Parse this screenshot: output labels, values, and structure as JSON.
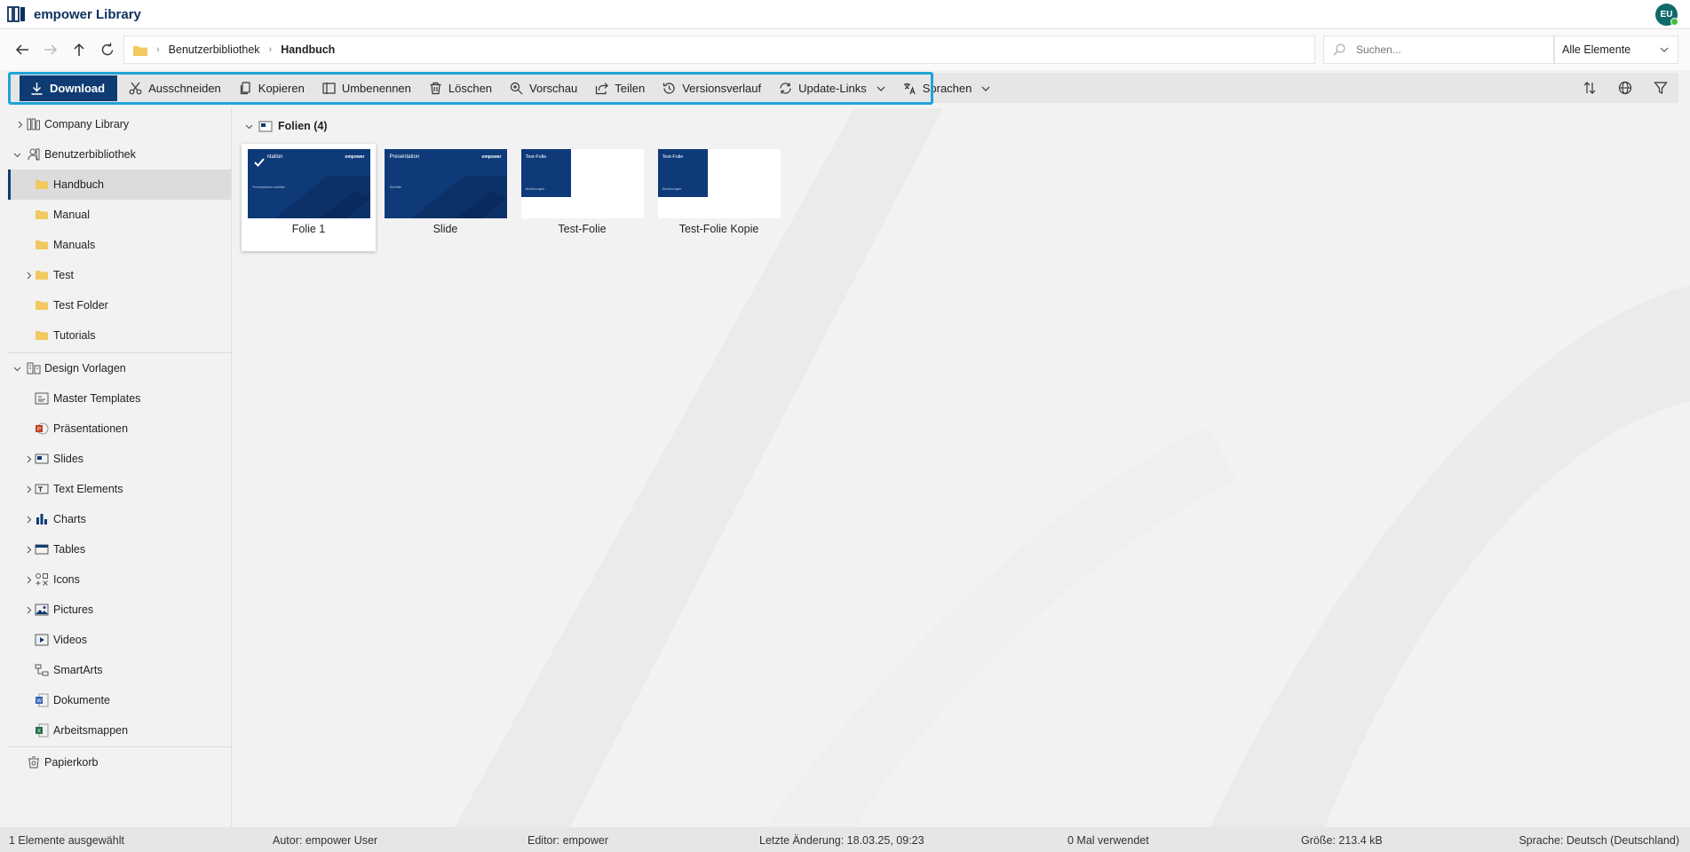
{
  "app": {
    "title": "empower Library",
    "avatar_initials": "EU"
  },
  "nav": {
    "breadcrumb": [
      "Benutzerbibliothek",
      "Handbuch"
    ],
    "search_placeholder": "Suchen...",
    "filter_value": "Alle Elemente"
  },
  "toolbar": {
    "items": [
      {
        "label": "Download",
        "icon": "download-icon"
      },
      {
        "label": "Ausschneiden",
        "icon": "scissors-icon"
      },
      {
        "label": "Kopieren",
        "icon": "copy-icon"
      },
      {
        "label": "Umbenennen",
        "icon": "rename-icon"
      },
      {
        "label": "Löschen",
        "icon": "trash-icon"
      },
      {
        "label": "Vorschau",
        "icon": "zoom-icon"
      },
      {
        "label": "Teilen",
        "icon": "share-icon"
      },
      {
        "label": "Versionsverlauf",
        "icon": "history-icon"
      },
      {
        "label": "Update-Links",
        "icon": "update-links-icon"
      },
      {
        "label": "Sprachen",
        "icon": "language-icon"
      }
    ],
    "right_icons": [
      "sort-icon",
      "globe-icon",
      "filter-icon"
    ]
  },
  "sidebar": {
    "items": [
      {
        "label": "Company Library"
      },
      {
        "label": "Benutzerbibliothek"
      },
      {
        "label": "Handbuch"
      },
      {
        "label": "Manual"
      },
      {
        "label": "Manuals"
      },
      {
        "label": "Test"
      },
      {
        "label": "Test Folder"
      },
      {
        "label": "Tutorials"
      },
      {
        "label": "Design Vorlagen"
      },
      {
        "label": "Master Templates"
      },
      {
        "label": "Präsentationen"
      },
      {
        "label": "Slides"
      },
      {
        "label": "Text Elements"
      },
      {
        "label": "Charts"
      },
      {
        "label": "Tables"
      },
      {
        "label": "Icons"
      },
      {
        "label": "Pictures"
      },
      {
        "label": "Videos"
      },
      {
        "label": "SmartArts"
      },
      {
        "label": "Dokumente"
      },
      {
        "label": "Arbeitsmappen"
      },
      {
        "label": "Papierkorb"
      }
    ]
  },
  "main": {
    "group_title": "Folien (4)",
    "tiles": [
      {
        "label": "Folie 1",
        "thumb_title": "ntation",
        "thumb_sub": "Presentation subtitle",
        "brand": "empower"
      },
      {
        "label": "Slide",
        "thumb_title": "Presentation",
        "thumb_sub": "Subtitle",
        "brand": "empower"
      },
      {
        "label": "Test-Folie",
        "thumb_title": "Test-Folie",
        "thumb_sub": "Änderungen"
      },
      {
        "label": "Test-Folie Kopie",
        "thumb_title": "Test-Folie",
        "thumb_sub": "Änderungen"
      }
    ]
  },
  "status": {
    "selected": "1 Elemente ausgewählt",
    "author": "Autor: empower User",
    "editor": "Editor: empower",
    "modified": "Letzte Änderung: 18.03.25, 09:23",
    "used": "0 Mal verwendet",
    "size": "Größe: 213.4 kB",
    "language": "Sprache: Deutsch (Deutschland)"
  },
  "colors": {
    "brand": "#0f3b73",
    "highlight": "#1fa3d6",
    "folder": "#f2c95e"
  }
}
